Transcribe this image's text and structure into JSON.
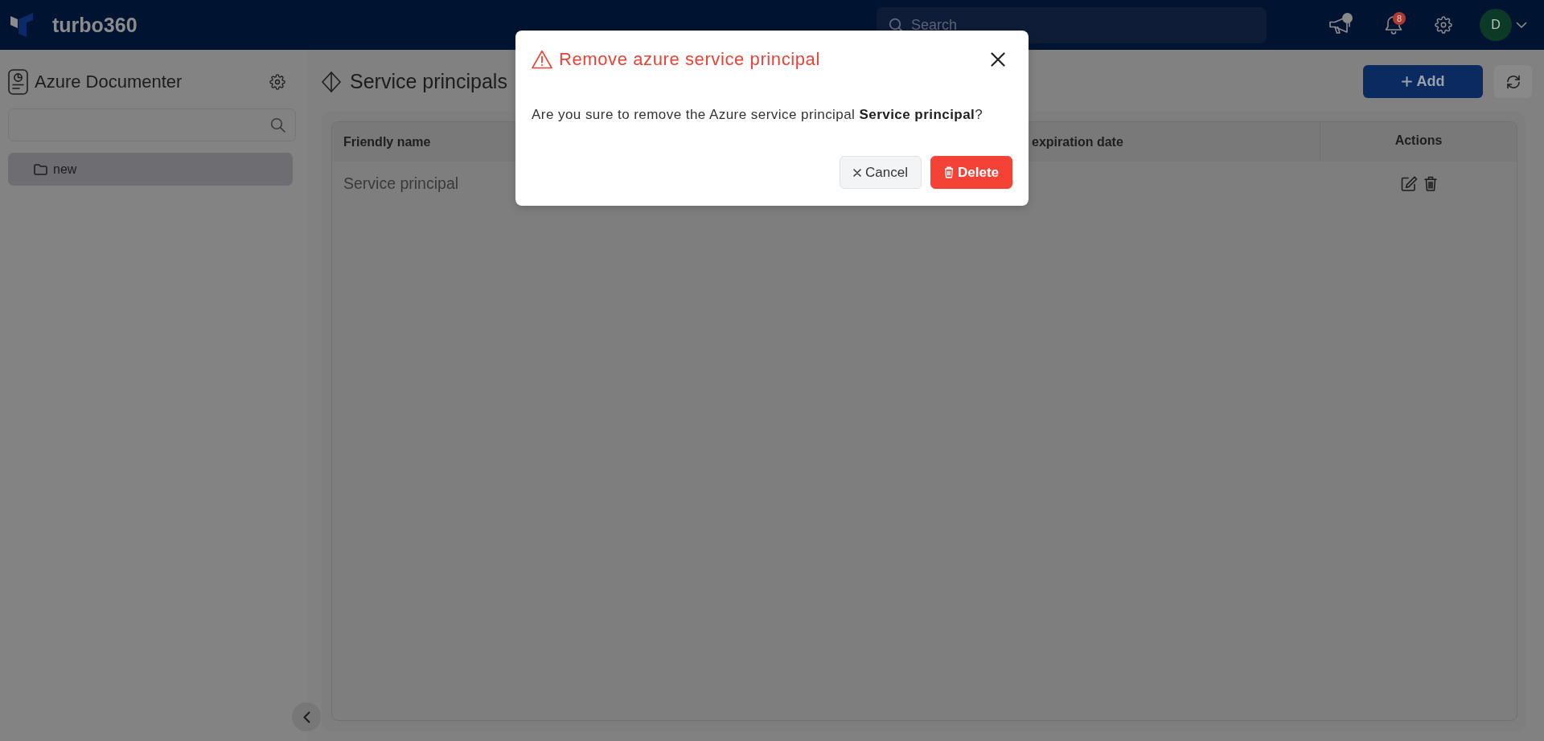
{
  "header": {
    "logo": "turbo360",
    "search": {
      "placeholder": "Search"
    },
    "announcements": {
      "unread": true
    },
    "notifications": {
      "count": "8"
    },
    "user": {
      "initial": "D"
    }
  },
  "sidebar": {
    "title": "Azure Documenter",
    "tree": [
      {
        "label": "new",
        "selected": true
      }
    ]
  },
  "page": {
    "title": "Service principals",
    "add_button": "Add"
  },
  "table": {
    "columns": [
      "Friendly name",
      "expiration date",
      "Actions"
    ],
    "rows": [
      {
        "friendly_name": "Service principal"
      }
    ]
  },
  "dialog": {
    "title": "Remove azure service principal",
    "message": "Are you sure to remove the Azure service principal **Service principal**?",
    "buttons": [
      {
        "label": "Cancel",
        "kind": "cancel"
      },
      {
        "label": "Delete",
        "kind": "danger"
      }
    ]
  }
}
